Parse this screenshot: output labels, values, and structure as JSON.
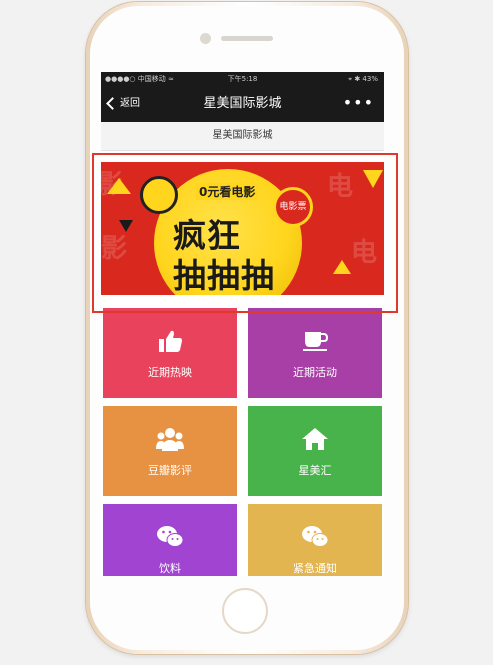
{
  "status_bar": {
    "carrier": "●●●●○ 中国移动 ≈",
    "time": "下午5:18",
    "battery": "⌖ ✱ 43%"
  },
  "nav": {
    "back_label": "返回",
    "title": "星美国际影城",
    "more_label": "•••"
  },
  "subheader": "星美国际影城",
  "banner": {
    "tag": "0元看电影",
    "headline_1": "疯狂",
    "headline_2": "抽抽抽",
    "badge": "电影票"
  },
  "tiles": [
    {
      "label": "近期热映",
      "icon": "thumbs-up-icon",
      "color": "#e8425d"
    },
    {
      "label": "近期活动",
      "icon": "coffee-cup-icon",
      "color": "#a83fa6"
    },
    {
      "label": "豆瓣影评",
      "icon": "group-icon",
      "color": "#e79243"
    },
    {
      "label": "星美汇",
      "icon": "home-icon",
      "color": "#48b24b"
    },
    {
      "label": "饮料",
      "icon": "wechat-icon",
      "color": "#a144d1"
    },
    {
      "label": "紧急通知",
      "icon": "wechat-icon",
      "color": "#e3b550"
    }
  ],
  "colors": {
    "highlight": "#e0382b",
    "nav_bg": "#1a1a1a",
    "banner_bg": "#d9291f",
    "banner_yellow": "#ffd51d"
  }
}
